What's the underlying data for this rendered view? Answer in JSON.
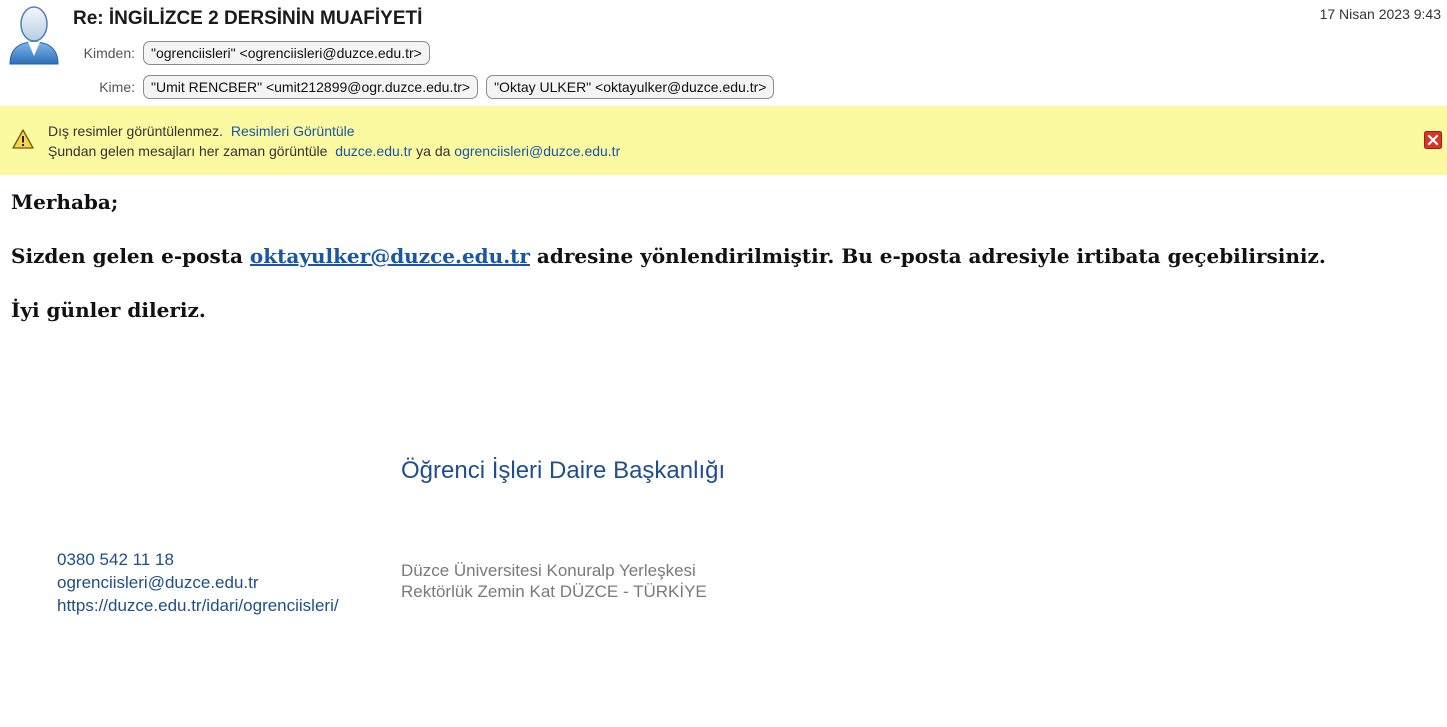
{
  "header": {
    "subject": "Re: İNGİLİZCE 2 DERSİNİN MUAFİYETİ",
    "date": "17 Nisan 2023 9:43",
    "from_label": "Kimden:",
    "from": [
      "\"ogrenciisleri\" <ogrenciisleri@duzce.edu.tr>"
    ],
    "to_label": "Kime:",
    "to": [
      "\"Umit RENCBER\" <umit212899@ogr.duzce.edu.tr>",
      "\"Oktay ULKER\" <oktayulker@duzce.edu.tr>"
    ],
    "avatar_icon": "user-avatar-icon"
  },
  "banner": {
    "line1_text": "Dış resimler görüntülenmez.",
    "line1_link": "Resimleri Görüntüle",
    "line2_text": "Şundan gelen mesajları her zaman görüntüle",
    "line2_link_domain": "duzce.edu.tr",
    "line2_or": "ya da",
    "line2_link_sender": "ogrenciisleri@duzce.edu.tr",
    "warning_icon": "warning-icon",
    "close_icon": "close-icon",
    "background_color": "#fbfaa0"
  },
  "body": {
    "greeting": "Merhaba;",
    "line2_before": "Sizden gelen e-posta",
    "line2_link": "oktayulker@duzce.edu.tr",
    "line2_after": "adresine yönlendirilmiştir. Bu e-posta adresiyle irtibata geçebilirsiniz.",
    "closing": "İyi günler dileriz."
  },
  "signature": {
    "title": "Öğrenci İşleri Daire Başkanlığı",
    "phone": "0380 542 11 18",
    "email": "ogrenciisleri@duzce.edu.tr",
    "website": "https://duzce.edu.tr/idari/ogrenciisleri/",
    "address_line1": "Düzce Üniversitesi Konuralp Yerleşkesi",
    "address_line2": "Rektörlük Zemin Kat DÜZCE - TÜRKİYE"
  },
  "colors": {
    "link": "#1a56a6",
    "signature_blue": "#1f4e8c",
    "signature_gray": "#7a7a7a"
  }
}
